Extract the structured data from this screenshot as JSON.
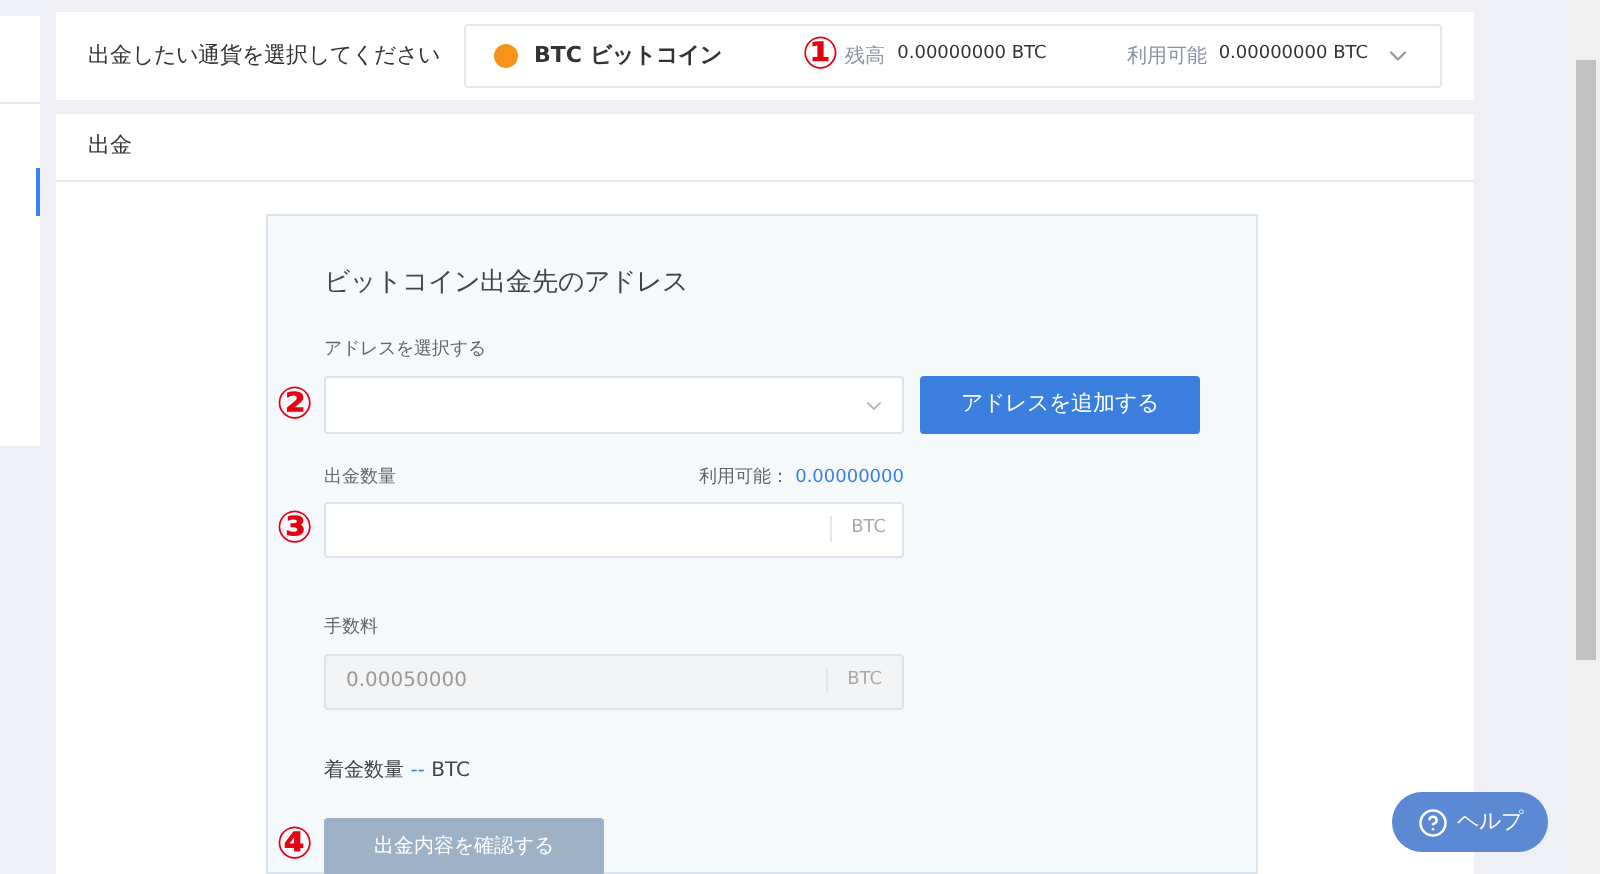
{
  "currency_bar": {
    "label": "出金したい通貨を選択してください",
    "symbol": "BTC",
    "name": "ビットコイン",
    "annotation": "①",
    "balance_label": "残高",
    "balance": "0.00000000 BTC",
    "available_label": "利用可能",
    "available": "0.00000000 BTC"
  },
  "section": {
    "title": "出金"
  },
  "form": {
    "title": "ビットコイン出金先のアドレス",
    "address": {
      "label": "アドレスを選択する",
      "annotation": "②",
      "button": "アドレスを追加する"
    },
    "amount": {
      "label": "出金数量",
      "available_label": "利用可能：",
      "available": "0.00000000",
      "annotation": "③",
      "unit": "BTC"
    },
    "fee": {
      "label": "手数料",
      "value": "0.00050000",
      "unit": "BTC",
      "disabled": true
    },
    "receive": {
      "label": "着金数量",
      "value": "--",
      "unit": "BTC"
    },
    "confirm": {
      "label": "出金内容を確認する",
      "annotation": "④",
      "disabled": true
    }
  },
  "help": {
    "label": "ヘルプ"
  }
}
